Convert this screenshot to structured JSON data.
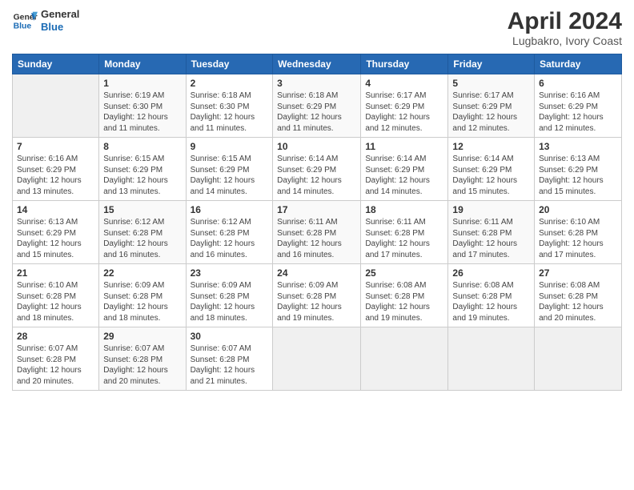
{
  "header": {
    "logo_line1": "General",
    "logo_line2": "Blue",
    "main_title": "April 2024",
    "subtitle": "Lugbakro, Ivory Coast"
  },
  "weekdays": [
    "Sunday",
    "Monday",
    "Tuesday",
    "Wednesday",
    "Thursday",
    "Friday",
    "Saturday"
  ],
  "weeks": [
    [
      {
        "day": "",
        "sunrise": "",
        "sunset": "",
        "daylight": ""
      },
      {
        "day": "1",
        "sunrise": "Sunrise: 6:19 AM",
        "sunset": "Sunset: 6:30 PM",
        "daylight": "Daylight: 12 hours and 11 minutes."
      },
      {
        "day": "2",
        "sunrise": "Sunrise: 6:18 AM",
        "sunset": "Sunset: 6:30 PM",
        "daylight": "Daylight: 12 hours and 11 minutes."
      },
      {
        "day": "3",
        "sunrise": "Sunrise: 6:18 AM",
        "sunset": "Sunset: 6:29 PM",
        "daylight": "Daylight: 12 hours and 11 minutes."
      },
      {
        "day": "4",
        "sunrise": "Sunrise: 6:17 AM",
        "sunset": "Sunset: 6:29 PM",
        "daylight": "Daylight: 12 hours and 12 minutes."
      },
      {
        "day": "5",
        "sunrise": "Sunrise: 6:17 AM",
        "sunset": "Sunset: 6:29 PM",
        "daylight": "Daylight: 12 hours and 12 minutes."
      },
      {
        "day": "6",
        "sunrise": "Sunrise: 6:16 AM",
        "sunset": "Sunset: 6:29 PM",
        "daylight": "Daylight: 12 hours and 12 minutes."
      }
    ],
    [
      {
        "day": "7",
        "sunrise": "Sunrise: 6:16 AM",
        "sunset": "Sunset: 6:29 PM",
        "daylight": "Daylight: 12 hours and 13 minutes."
      },
      {
        "day": "8",
        "sunrise": "Sunrise: 6:15 AM",
        "sunset": "Sunset: 6:29 PM",
        "daylight": "Daylight: 12 hours and 13 minutes."
      },
      {
        "day": "9",
        "sunrise": "Sunrise: 6:15 AM",
        "sunset": "Sunset: 6:29 PM",
        "daylight": "Daylight: 12 hours and 14 minutes."
      },
      {
        "day": "10",
        "sunrise": "Sunrise: 6:14 AM",
        "sunset": "Sunset: 6:29 PM",
        "daylight": "Daylight: 12 hours and 14 minutes."
      },
      {
        "day": "11",
        "sunrise": "Sunrise: 6:14 AM",
        "sunset": "Sunset: 6:29 PM",
        "daylight": "Daylight: 12 hours and 14 minutes."
      },
      {
        "day": "12",
        "sunrise": "Sunrise: 6:14 AM",
        "sunset": "Sunset: 6:29 PM",
        "daylight": "Daylight: 12 hours and 15 minutes."
      },
      {
        "day": "13",
        "sunrise": "Sunrise: 6:13 AM",
        "sunset": "Sunset: 6:29 PM",
        "daylight": "Daylight: 12 hours and 15 minutes."
      }
    ],
    [
      {
        "day": "14",
        "sunrise": "Sunrise: 6:13 AM",
        "sunset": "Sunset: 6:29 PM",
        "daylight": "Daylight: 12 hours and 15 minutes."
      },
      {
        "day": "15",
        "sunrise": "Sunrise: 6:12 AM",
        "sunset": "Sunset: 6:28 PM",
        "daylight": "Daylight: 12 hours and 16 minutes."
      },
      {
        "day": "16",
        "sunrise": "Sunrise: 6:12 AM",
        "sunset": "Sunset: 6:28 PM",
        "daylight": "Daylight: 12 hours and 16 minutes."
      },
      {
        "day": "17",
        "sunrise": "Sunrise: 6:11 AM",
        "sunset": "Sunset: 6:28 PM",
        "daylight": "Daylight: 12 hours and 16 minutes."
      },
      {
        "day": "18",
        "sunrise": "Sunrise: 6:11 AM",
        "sunset": "Sunset: 6:28 PM",
        "daylight": "Daylight: 12 hours and 17 minutes."
      },
      {
        "day": "19",
        "sunrise": "Sunrise: 6:11 AM",
        "sunset": "Sunset: 6:28 PM",
        "daylight": "Daylight: 12 hours and 17 minutes."
      },
      {
        "day": "20",
        "sunrise": "Sunrise: 6:10 AM",
        "sunset": "Sunset: 6:28 PM",
        "daylight": "Daylight: 12 hours and 17 minutes."
      }
    ],
    [
      {
        "day": "21",
        "sunrise": "Sunrise: 6:10 AM",
        "sunset": "Sunset: 6:28 PM",
        "daylight": "Daylight: 12 hours and 18 minutes."
      },
      {
        "day": "22",
        "sunrise": "Sunrise: 6:09 AM",
        "sunset": "Sunset: 6:28 PM",
        "daylight": "Daylight: 12 hours and 18 minutes."
      },
      {
        "day": "23",
        "sunrise": "Sunrise: 6:09 AM",
        "sunset": "Sunset: 6:28 PM",
        "daylight": "Daylight: 12 hours and 18 minutes."
      },
      {
        "day": "24",
        "sunrise": "Sunrise: 6:09 AM",
        "sunset": "Sunset: 6:28 PM",
        "daylight": "Daylight: 12 hours and 19 minutes."
      },
      {
        "day": "25",
        "sunrise": "Sunrise: 6:08 AM",
        "sunset": "Sunset: 6:28 PM",
        "daylight": "Daylight: 12 hours and 19 minutes."
      },
      {
        "day": "26",
        "sunrise": "Sunrise: 6:08 AM",
        "sunset": "Sunset: 6:28 PM",
        "daylight": "Daylight: 12 hours and 19 minutes."
      },
      {
        "day": "27",
        "sunrise": "Sunrise: 6:08 AM",
        "sunset": "Sunset: 6:28 PM",
        "daylight": "Daylight: 12 hours and 20 minutes."
      }
    ],
    [
      {
        "day": "28",
        "sunrise": "Sunrise: 6:07 AM",
        "sunset": "Sunset: 6:28 PM",
        "daylight": "Daylight: 12 hours and 20 minutes."
      },
      {
        "day": "29",
        "sunrise": "Sunrise: 6:07 AM",
        "sunset": "Sunset: 6:28 PM",
        "daylight": "Daylight: 12 hours and 20 minutes."
      },
      {
        "day": "30",
        "sunrise": "Sunrise: 6:07 AM",
        "sunset": "Sunset: 6:28 PM",
        "daylight": "Daylight: 12 hours and 21 minutes."
      },
      {
        "day": "",
        "sunrise": "",
        "sunset": "",
        "daylight": ""
      },
      {
        "day": "",
        "sunrise": "",
        "sunset": "",
        "daylight": ""
      },
      {
        "day": "",
        "sunrise": "",
        "sunset": "",
        "daylight": ""
      },
      {
        "day": "",
        "sunrise": "",
        "sunset": "",
        "daylight": ""
      }
    ]
  ]
}
